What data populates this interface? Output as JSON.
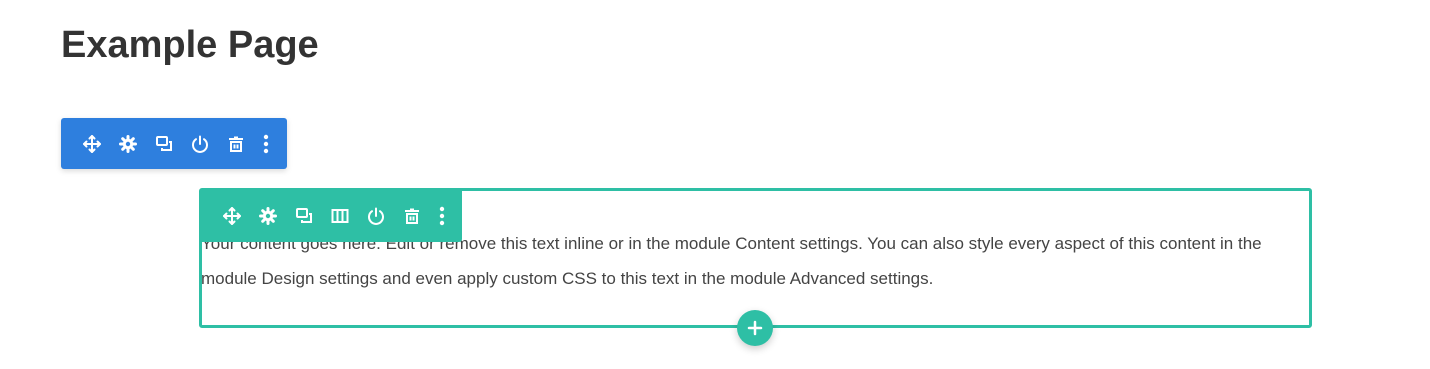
{
  "page": {
    "title": "Example Page"
  },
  "section_toolbar": {
    "color": "#2e7fde",
    "icons": [
      "move-icon",
      "gear-icon",
      "duplicate-icon",
      "power-icon",
      "trash-icon",
      "more-vertical-icon"
    ]
  },
  "row_toolbar": {
    "color": "#2ebfa5",
    "icons": [
      "move-icon",
      "gear-icon",
      "duplicate-icon",
      "columns-icon",
      "power-icon",
      "trash-icon",
      "more-vertical-icon"
    ]
  },
  "module": {
    "text": "Your content goes here. Edit or remove this text inline or in the module Content settings. You can also style every aspect of this content in the module Design settings and even apply custom CSS to this text in the module Advanced settings."
  },
  "add_button": {
    "icon": "plus-icon",
    "color": "#2ebfa5"
  }
}
